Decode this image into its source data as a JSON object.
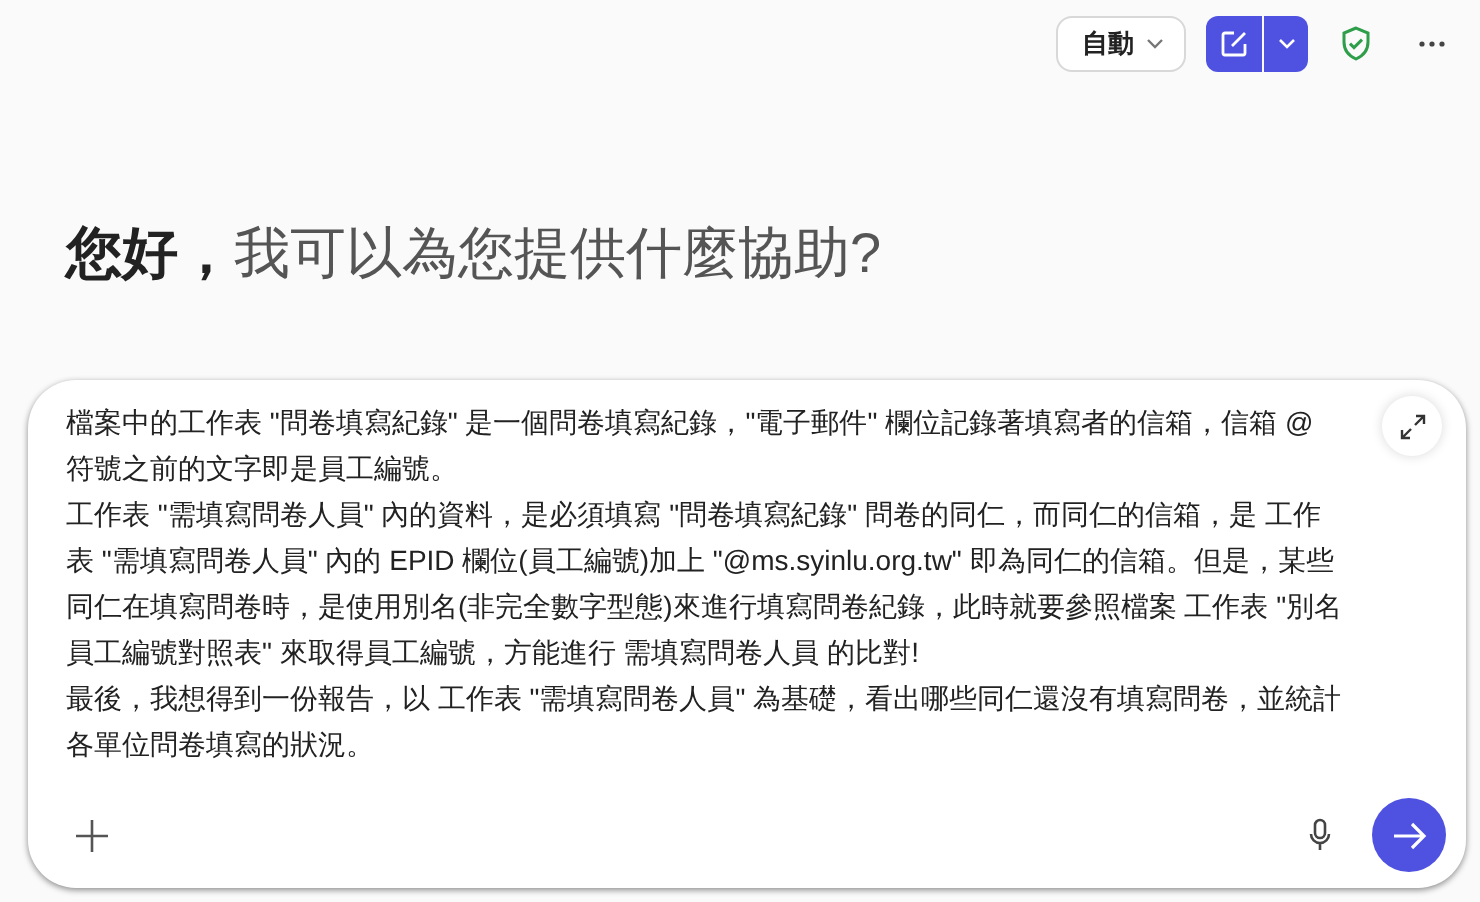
{
  "toolbar": {
    "mode": "自動"
  },
  "greeting": {
    "hello": "您好，",
    "question": "我可以為您提供什麼協助?"
  },
  "composer": {
    "paragraphs": [
      "檔案中的工作表 \"問卷填寫紀錄\" 是一個問卷填寫紀錄，\"電子郵件\" 欄位記錄著填寫者的信箱，信箱 @ 符號之前的文字即是員工編號。",
      "工作表 \"需填寫問卷人員\" 內的資料，是必須填寫 \"問卷填寫紀錄\" 問卷的同仁，而同仁的信箱，是 工作表 \"需填寫問卷人員\" 內的 EPID 欄位(員工編號)加上 \"@ms.syinlu.org.tw\" 即為同仁的信箱。但是，某些同仁在填寫問卷時，是使用別名(非完全數字型態)來進行填寫問卷紀錄，此時就要參照檔案 工作表 \"別名員工編號對照表\" 來取得員工編號，方能進行 需填寫問卷人員 的比對!",
      "最後，我想得到一份報告，以 工作表 \"需填寫問卷人員\" 為基礎，看出哪些同仁還沒有填寫問卷，並統計各單位問卷填寫的狀況。"
    ]
  }
}
